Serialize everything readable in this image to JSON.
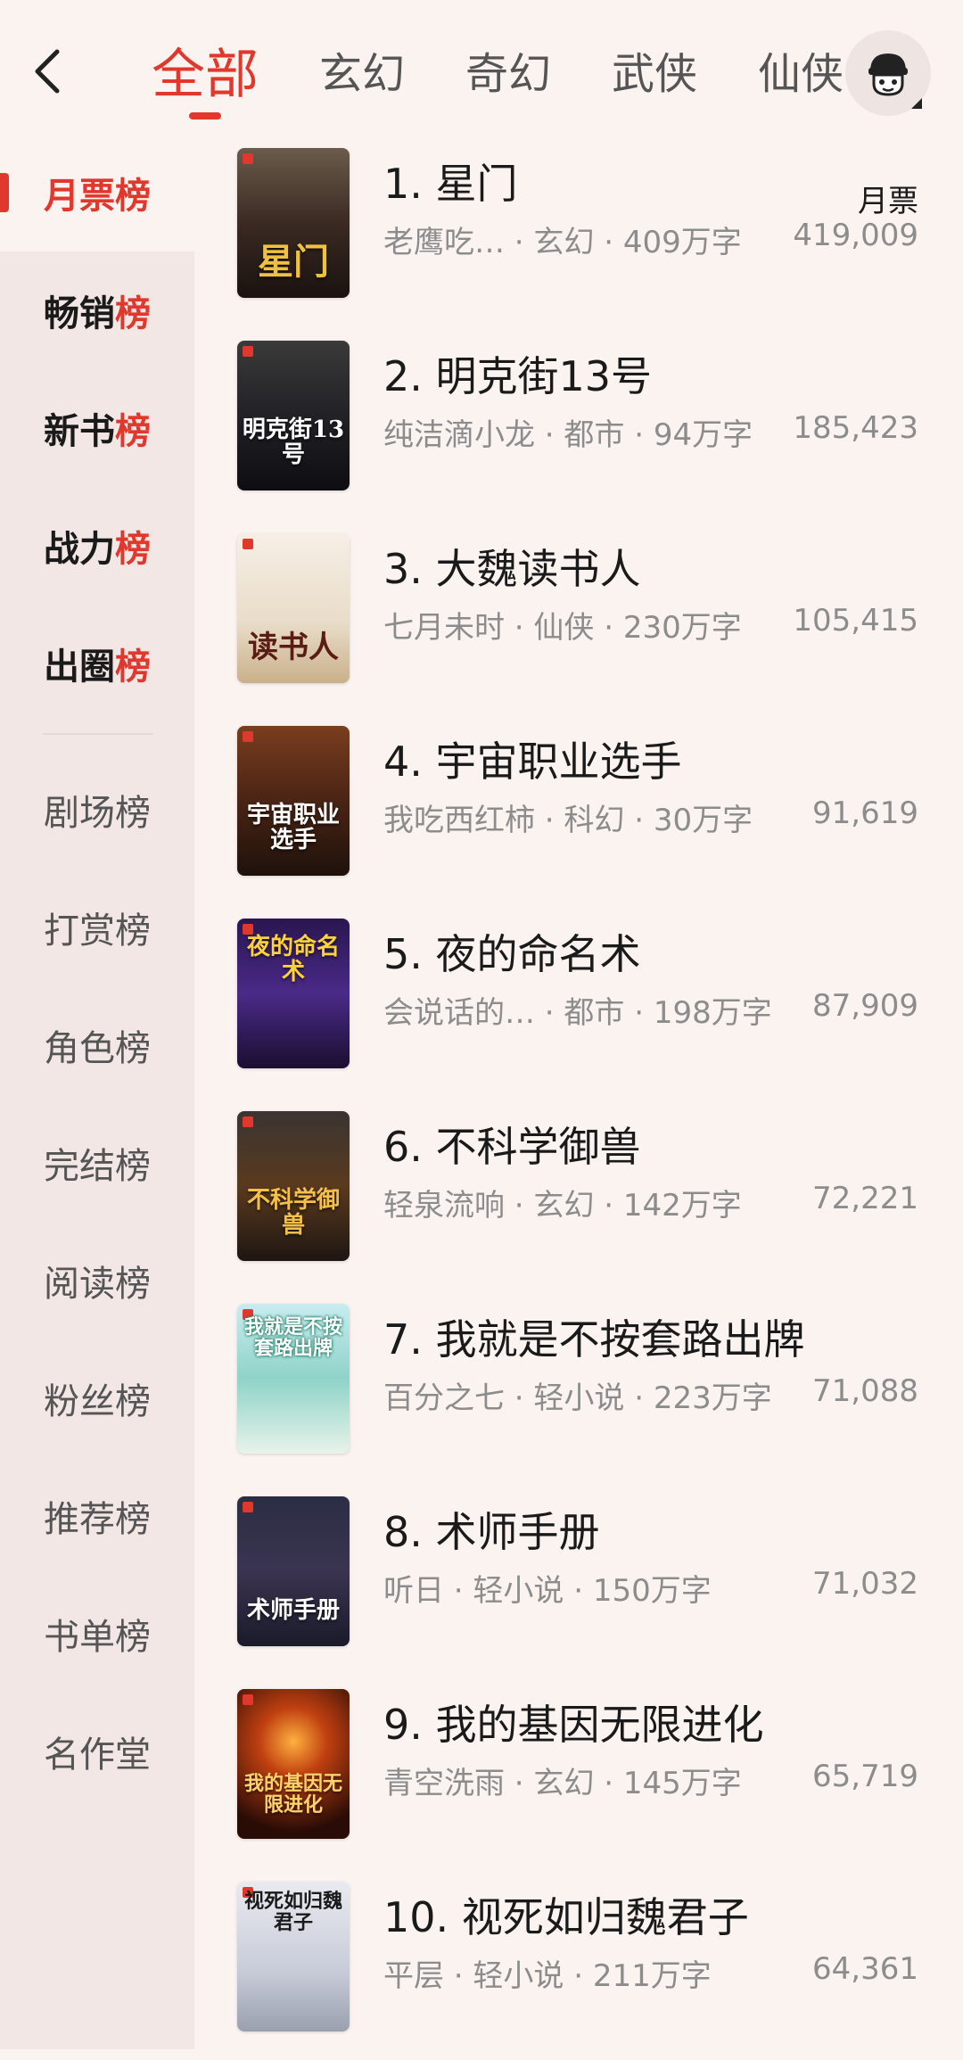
{
  "header": {
    "tabs": [
      {
        "label": "全部",
        "active": true
      },
      {
        "label": "玄幻"
      },
      {
        "label": "奇幻"
      },
      {
        "label": "武侠"
      },
      {
        "label": "仙侠"
      }
    ],
    "back_icon": "chevron-left-icon",
    "avatar_icon": "mascot-avatar-icon"
  },
  "sidebar": {
    "items": [
      {
        "label": "月票榜",
        "active": true
      },
      {
        "label": "畅销",
        "accent": "榜"
      },
      {
        "label": "新书",
        "accent": "榜"
      },
      {
        "label": "战力",
        "accent": "榜"
      },
      {
        "label": "出圈",
        "accent": "榜"
      },
      {
        "label": "剧场榜"
      },
      {
        "label": "打赏榜"
      },
      {
        "label": "角色榜"
      },
      {
        "label": "完结榜"
      },
      {
        "label": "阅读榜"
      },
      {
        "label": "粉丝榜"
      },
      {
        "label": "推荐榜"
      },
      {
        "label": "书单榜"
      },
      {
        "label": "名作堂"
      }
    ]
  },
  "list": {
    "column_header": "月票",
    "books": [
      {
        "title": "1. 星门",
        "meta": "老鹰吃…  · 玄幻 · 409万字",
        "value": "419,009",
        "cover_text": "星门"
      },
      {
        "title": "2. 明克街13号",
        "meta": "纯洁滴小龙 · 都市 · 94万字",
        "value": "185,423",
        "cover_text": "明克街13号"
      },
      {
        "title": "3. 大魏读书人",
        "meta": "七月未时 · 仙侠 · 230万字",
        "value": "105,415",
        "cover_text": "读书人"
      },
      {
        "title": "4. 宇宙职业选手",
        "meta": "我吃西红柿 · 科幻 · 30万字",
        "value": "91,619",
        "cover_text": "宇宙职业选手"
      },
      {
        "title": "5. 夜的命名术",
        "meta": "会说话的… · 都市 · 198万字",
        "value": "87,909",
        "cover_text": "夜的命名术"
      },
      {
        "title": "6. 不科学御兽",
        "meta": "轻泉流响 · 玄幻 · 142万字",
        "value": "72,221",
        "cover_text": "不科学御兽"
      },
      {
        "title": "7. 我就是不按套路出牌",
        "meta": "百分之七 · 轻小说 · 223万字",
        "value": "71,088",
        "cover_text": "我就是不按套路出牌"
      },
      {
        "title": "8. 术师手册",
        "meta": "听日 · 轻小说 · 150万字",
        "value": "71,032",
        "cover_text": "术师手册"
      },
      {
        "title": "9. 我的基因无限进化",
        "meta": "青空洗雨 · 玄幻 · 145万字",
        "value": "65,719",
        "cover_text": "我的基因无限进化"
      },
      {
        "title": "10. 视死如归魏君子",
        "meta": "平层 · 轻小说 · 211万字",
        "value": "64,361",
        "cover_text": "视死如归魏君子"
      }
    ]
  },
  "colors": {
    "accent": "#e1382e",
    "background": "#fbf3f0",
    "sidebar_bg": "#f2e7e4",
    "muted_text": "#8c8c8c"
  }
}
